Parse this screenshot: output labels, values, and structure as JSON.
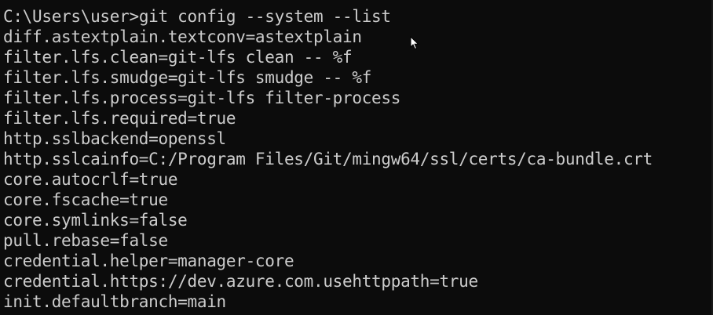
{
  "terminal": {
    "prompt": "C:\\Users\\user>",
    "command": "git config --system --list",
    "output_lines": [
      "diff.astextplain.textconv=astextplain",
      "filter.lfs.clean=git-lfs clean -- %f",
      "filter.lfs.smudge=git-lfs smudge -- %f",
      "filter.lfs.process=git-lfs filter-process",
      "filter.lfs.required=true",
      "http.sslbackend=openssl",
      "http.sslcainfo=C:/Program Files/Git/mingw64/ssl/certs/ca-bundle.crt",
      "core.autocrlf=true",
      "core.fscache=true",
      "core.symlinks=false",
      "pull.rebase=false",
      "credential.helper=manager-core",
      "credential.https://dev.azure.com.usehttppath=true",
      "init.defaultbranch=main"
    ]
  },
  "colors": {
    "background": "#0c0c0c",
    "foreground": "#cccccc"
  },
  "icons": {
    "cursor": "mouse-pointer-icon"
  }
}
